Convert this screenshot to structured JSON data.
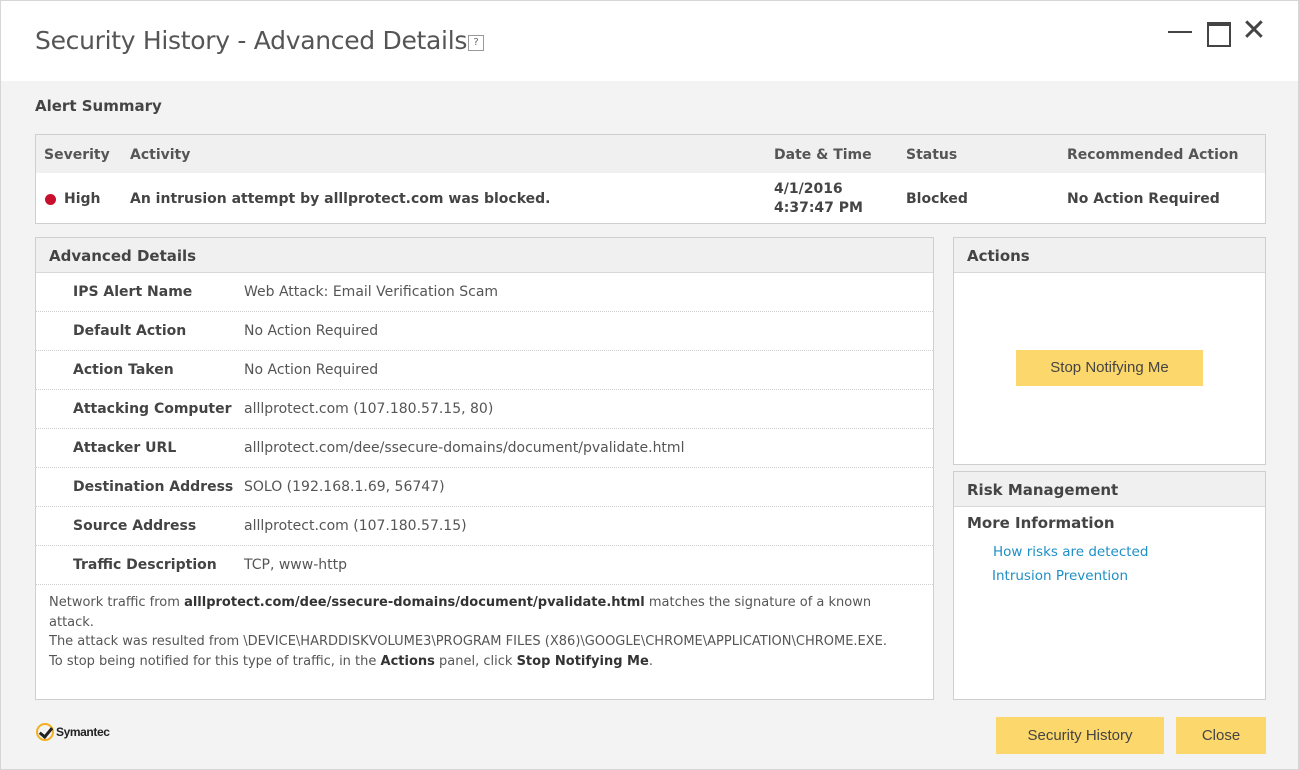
{
  "window": {
    "title": "Security History - Advanced Details",
    "help_glyph": "?",
    "close_glyph": "✕"
  },
  "alert_summary": {
    "label": "Alert Summary",
    "headers": {
      "severity": "Severity",
      "activity": "Activity",
      "datetime": "Date & Time",
      "status": "Status",
      "action": "Recommended Action"
    },
    "row": {
      "severity": "High",
      "severity_color": "#c8102e",
      "activity": "An intrusion attempt by alllprotect.com was blocked.",
      "date": "4/1/2016",
      "time": "4:37:47 PM",
      "status": "Blocked",
      "action": "No Action Required"
    }
  },
  "advanced_details": {
    "title": "Advanced Details",
    "rows": [
      {
        "key": "IPS Alert Name",
        "value": "Web Attack: Email Verification Scam"
      },
      {
        "key": "Default Action",
        "value": "No Action Required"
      },
      {
        "key": "Action Taken",
        "value": "No Action Required"
      },
      {
        "key": "Attacking Computer",
        "value": "alllprotect.com (107.180.57.15, 80)"
      },
      {
        "key": "Attacker URL",
        "value": "alllprotect.com/dee/ssecure-domains/document/pvalidate.html"
      },
      {
        "key": "Destination Address",
        "value": "SOLO (192.168.1.69, 56747)"
      },
      {
        "key": "Source Address",
        "value": "alllprotect.com (107.180.57.15)"
      },
      {
        "key": "Traffic Description",
        "value": "TCP, www-http"
      }
    ],
    "description": {
      "p1_a": "Network traffic from ",
      "p1_b": "alllprotect.com/dee/ssecure-domains/document/pvalidate.html",
      "p1_c": " matches the signature of a known attack.",
      "p2": "The attack was resulted from \\DEVICE\\HARDDISKVOLUME3\\PROGRAM FILES (X86)\\GOOGLE\\CHROME\\APPLICATION\\CHROME.EXE.",
      "p3_a": "To stop being notified for this type of traffic, in the ",
      "p3_b": "Actions",
      "p3_c": " panel, click ",
      "p3_d": "Stop Notifying Me",
      "p3_e": "."
    }
  },
  "actions": {
    "title": "Actions",
    "stop_button": "Stop Notifying Me"
  },
  "risk_management": {
    "title": "Risk Management",
    "more_info": "More Information",
    "links": [
      "How risks are detected",
      "Intrusion Prevention"
    ]
  },
  "footer": {
    "brand": "Symantec",
    "history_button": "Security History",
    "close_button": "Close",
    "button_color": "#fcd76b"
  }
}
